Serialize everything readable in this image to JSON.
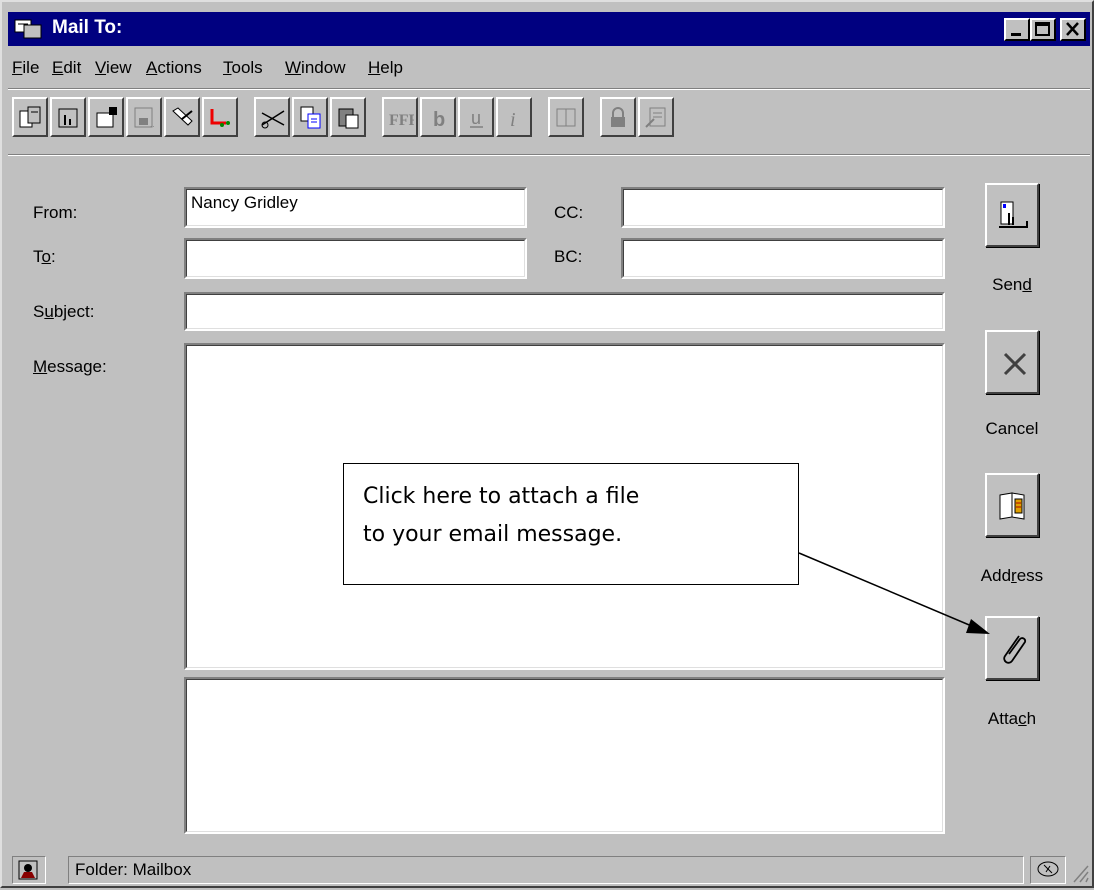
{
  "window": {
    "title": "Mail To:",
    "controls": [
      "minimize",
      "maximize",
      "close"
    ]
  },
  "menu": {
    "items": [
      {
        "label": "File",
        "mnemonic": "F"
      },
      {
        "label": "Edit",
        "mnemonic": "E"
      },
      {
        "label": "View",
        "mnemonic": "V"
      },
      {
        "label": "Actions",
        "mnemonic": "A"
      },
      {
        "label": "Tools",
        "mnemonic": "T"
      },
      {
        "label": "Window",
        "mnemonic": "W"
      },
      {
        "label": "Help",
        "mnemonic": "H"
      }
    ]
  },
  "toolbar": {
    "icons": [
      "new-message-icon",
      "send-icon",
      "properties-icon",
      "save-draft-icon",
      "spell-check-icon",
      "send-options-icon",
      "cut-icon",
      "copy-icon",
      "paste-icon",
      "font-icon",
      "bold-icon",
      "underline-icon",
      "italic-icon",
      "address-book-icon",
      "security-icon",
      "signature-icon"
    ]
  },
  "form": {
    "from_label": "From:",
    "from_value": "Nancy Gridley",
    "to_label": "To:",
    "to_value": "",
    "cc_label": "CC:",
    "cc_value": "",
    "bc_label": "BC:",
    "bc_value": "",
    "subject_label": "Subject:",
    "subject_value": "",
    "message_label": "Message:",
    "message_value": ""
  },
  "side_buttons": {
    "send": "Send",
    "cancel": "Cancel",
    "address": "Address",
    "attach": "Attach"
  },
  "callout": {
    "line1": "Click here to attach a file",
    "line2": "to your email message."
  },
  "status": {
    "folder": "Folder: Mailbox"
  }
}
